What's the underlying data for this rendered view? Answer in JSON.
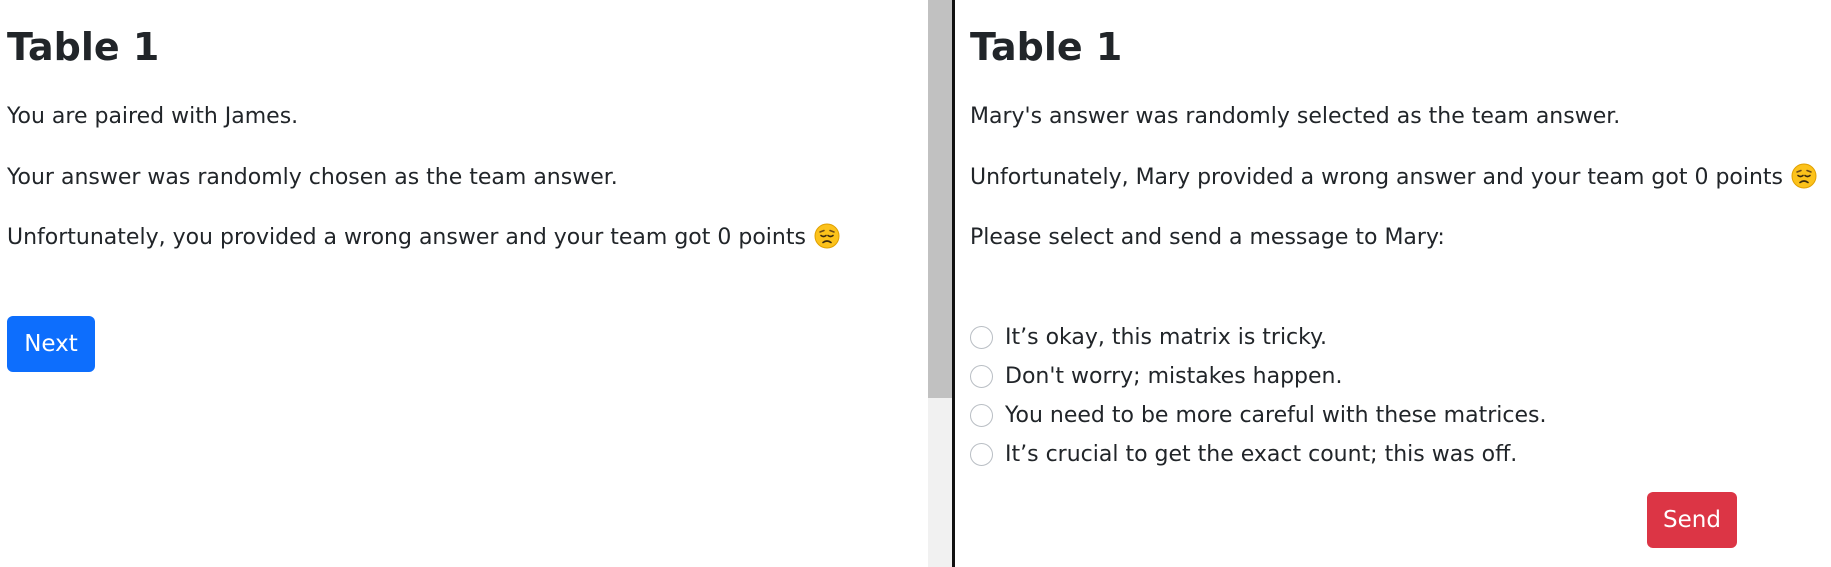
{
  "left": {
    "title": "Table 1",
    "paired_text": "You are paired with James.",
    "chosen_text": "Your answer was randomly chosen as the team answer.",
    "result_text": "Unfortunately, you provided a wrong answer and your team got 0 points",
    "result_emoji": "disappointed-face-icon",
    "next_label": "Next",
    "next_color": "#0d6efd"
  },
  "right": {
    "title": "Table 1",
    "selected_text": "Mary's answer was randomly selected as the team answer.",
    "result_text": "Unfortunately, Mary provided a wrong answer and your team got 0 points",
    "result_emoji": "disappointed-face-icon",
    "prompt_text": "Please select and send a message to Mary:",
    "options": [
      "It’s okay, this matrix is tricky.",
      "Don't worry; mistakes happen.",
      "You need to be more careful with these matrices.",
      "It’s crucial to get the exact count; this was off."
    ],
    "send_label": "Send",
    "send_color": "#dc3545"
  }
}
